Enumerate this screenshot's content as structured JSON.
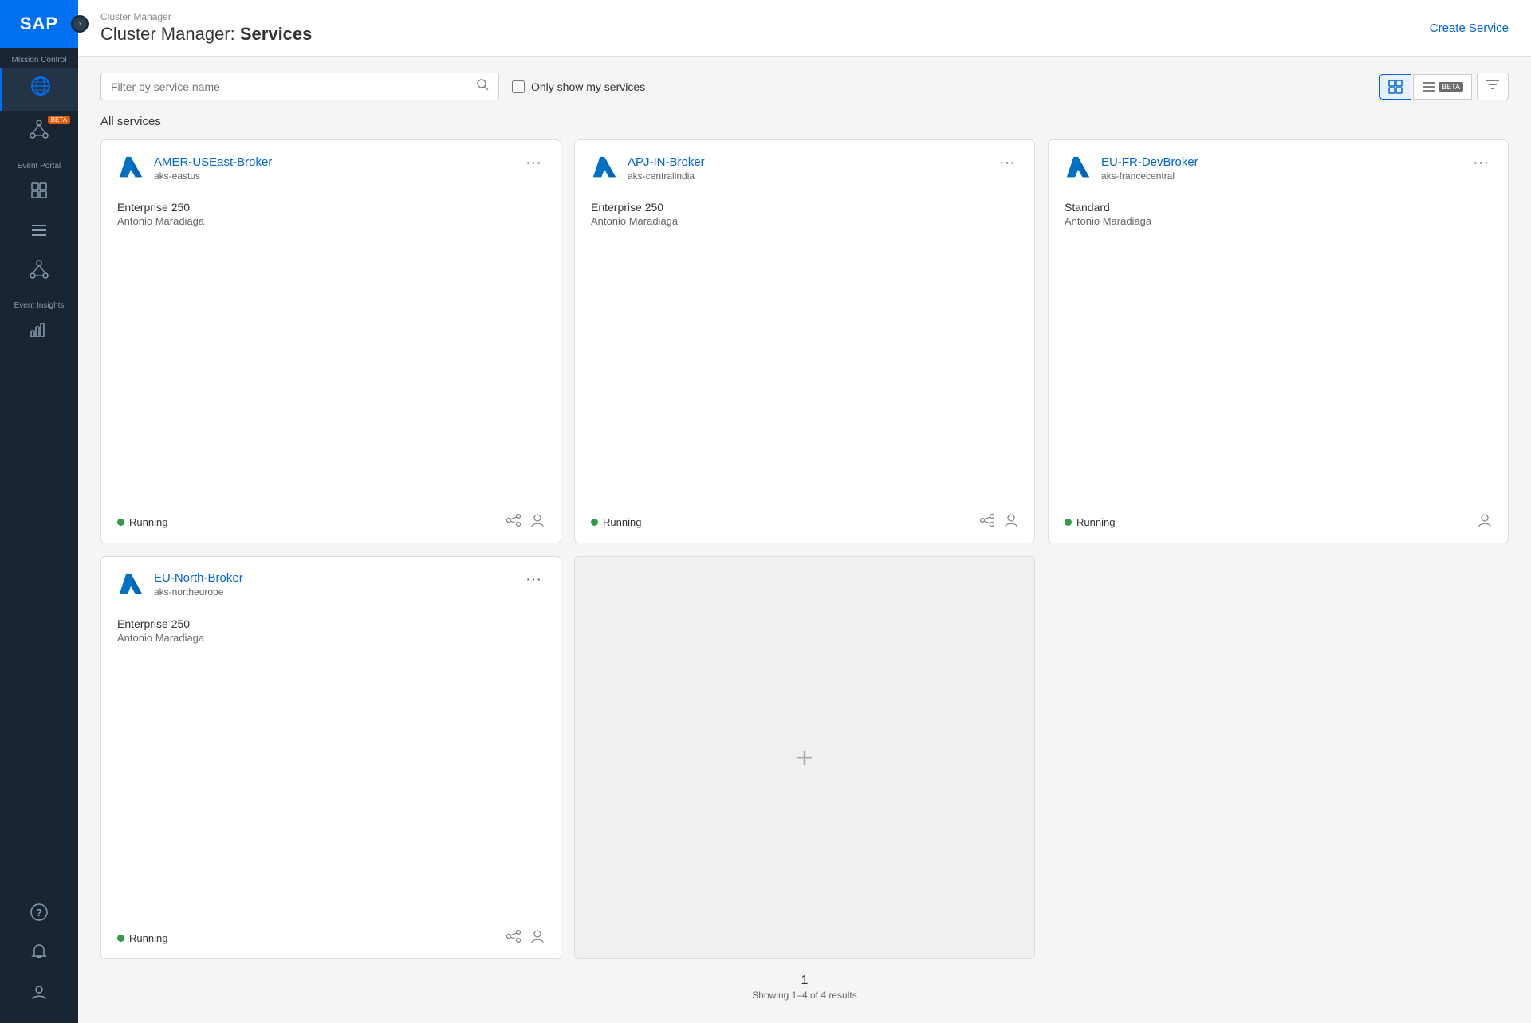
{
  "sidebar": {
    "logo": "SAP",
    "toggle_icon": "›",
    "sections": [
      {
        "label": "Mission Control",
        "items": [
          {
            "id": "mission-control",
            "icon": "🌐",
            "active": true,
            "label": ""
          }
        ]
      },
      {
        "label": "",
        "items": [
          {
            "id": "beta-feature",
            "icon": "⬡",
            "active": false,
            "label": "",
            "beta": true
          }
        ]
      },
      {
        "label": "Event Portal",
        "items": [
          {
            "id": "event-portal-1",
            "icon": "⊞",
            "active": false,
            "label": ""
          },
          {
            "id": "event-portal-2",
            "icon": "≡",
            "active": false,
            "label": ""
          },
          {
            "id": "event-portal-3",
            "icon": "⊕",
            "active": false,
            "label": ""
          }
        ]
      },
      {
        "label": "Event Insights",
        "items": [
          {
            "id": "event-insights",
            "icon": "📊",
            "active": false,
            "label": ""
          }
        ]
      }
    ],
    "bottom_items": [
      {
        "id": "help",
        "icon": "?"
      },
      {
        "id": "notifications",
        "icon": "🔔"
      },
      {
        "id": "user",
        "icon": "👤"
      }
    ]
  },
  "header": {
    "breadcrumb": "Cluster Manager",
    "title_prefix": "Cluster Manager: ",
    "title_bold": "Services",
    "create_service_label": "Create Service"
  },
  "toolbar": {
    "search_placeholder": "Filter by service name",
    "only_my_services_label": "Only show my services",
    "view_grid_label": "Grid view",
    "view_list_label": "List view",
    "beta_label": "BETA",
    "filter_label": "Filter"
  },
  "content": {
    "section_label": "All services",
    "services": [
      {
        "id": "amer-useast-broker",
        "name": "AMER-USEast-Broker",
        "sub": "aks-eastus",
        "plan": "Enterprise 250",
        "owner": "Antonio Maradiaga",
        "status": "Running",
        "status_color": "#2e9e45"
      },
      {
        "id": "apj-in-broker",
        "name": "APJ-IN-Broker",
        "sub": "aks-centralindia",
        "plan": "Enterprise 250",
        "owner": "Antonio Maradiaga",
        "status": "Running",
        "status_color": "#2e9e45"
      },
      {
        "id": "eu-fr-devbroker",
        "name": "EU-FR-DevBroker",
        "sub": "aks-francecentral",
        "plan": "Standard",
        "owner": "Antonio Maradiaga",
        "status": "Running",
        "status_color": "#2e9e45"
      },
      {
        "id": "eu-north-broker",
        "name": "EU-North-Broker",
        "sub": "aks-northeurope",
        "plan": "Enterprise 250",
        "owner": "Antonio Maradiaga",
        "status": "Running",
        "status_color": "#2e9e45"
      }
    ]
  },
  "pagination": {
    "page": "1",
    "info": "Showing 1–4 of 4 results"
  }
}
